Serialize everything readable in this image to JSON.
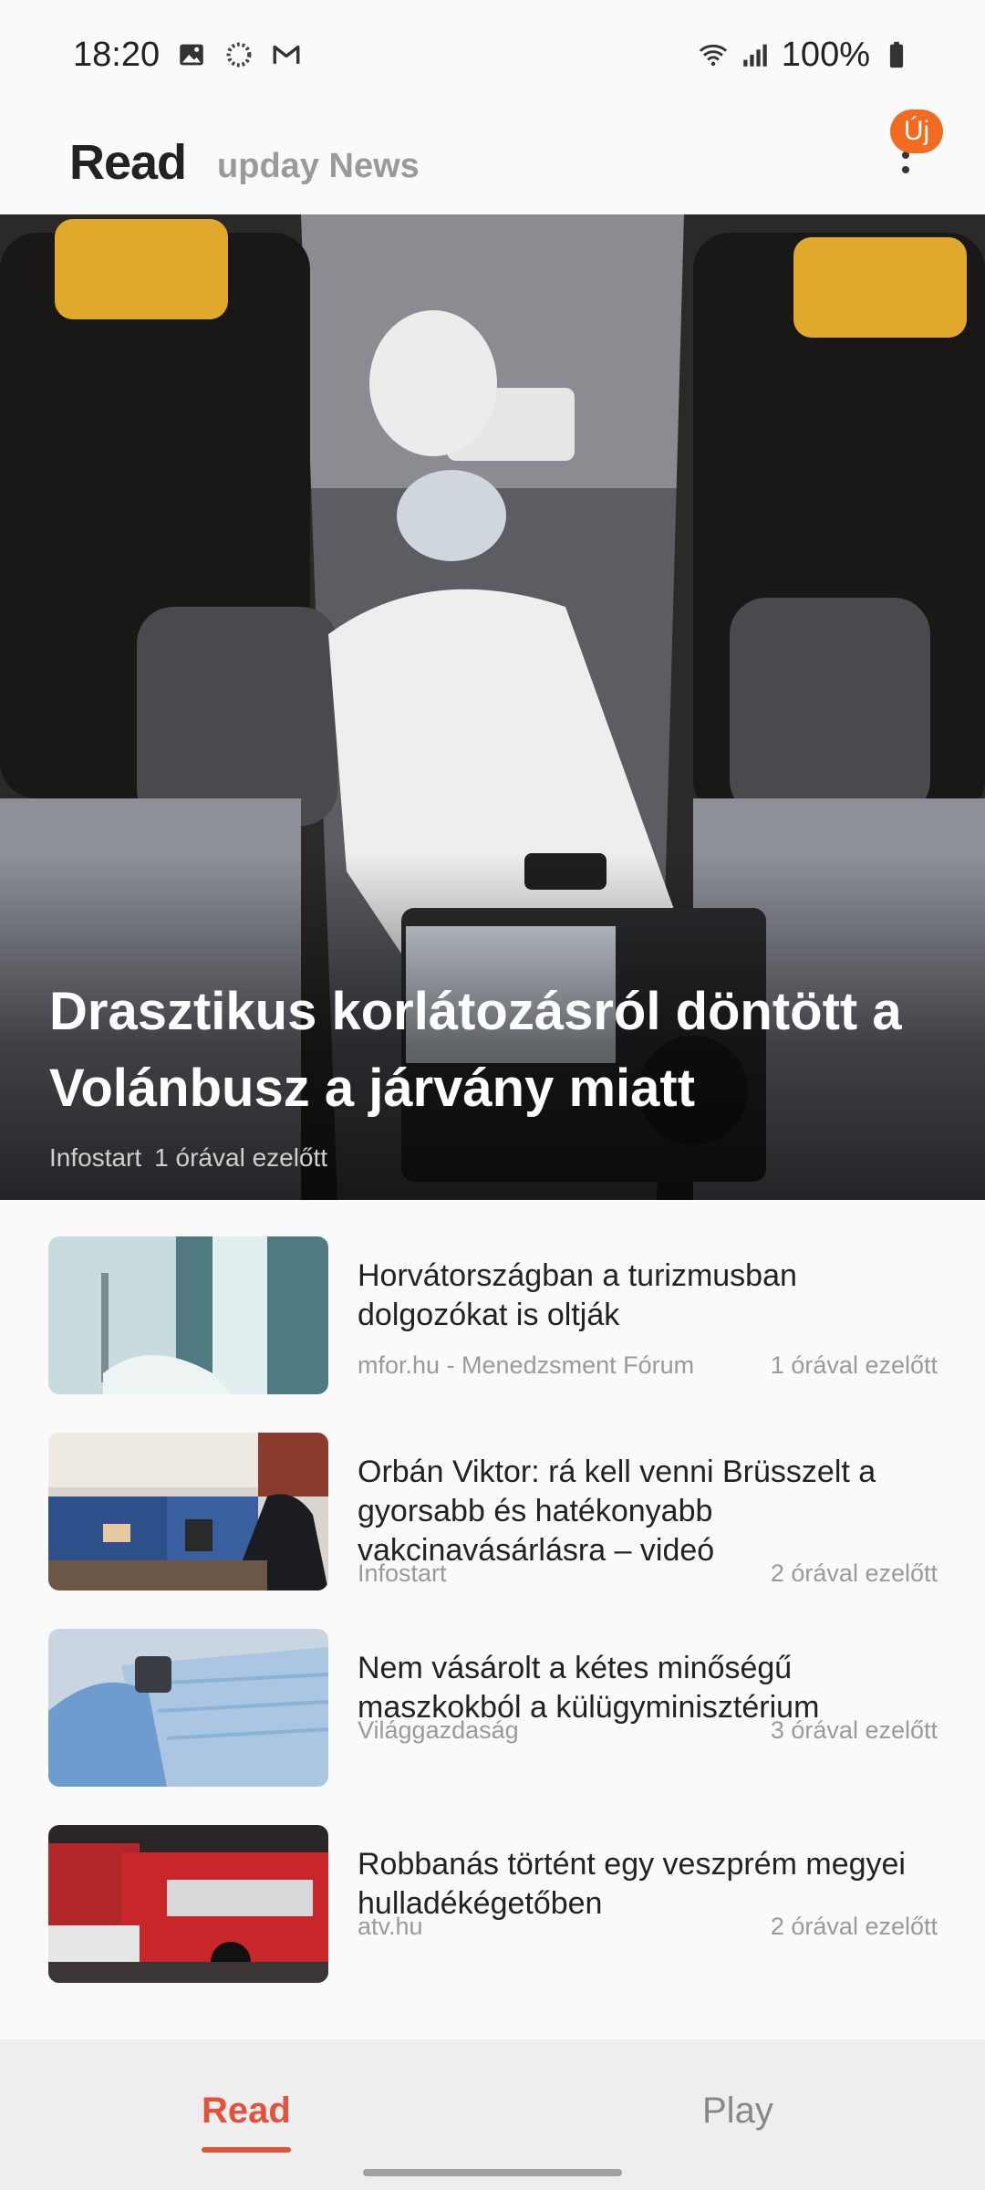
{
  "status_bar": {
    "time": "18:20",
    "battery": "100%",
    "icons": [
      "image-icon",
      "sync-icon",
      "gmail-icon",
      "wifi-icon",
      "signal-icon",
      "battery-icon"
    ]
  },
  "header": {
    "title": "Read",
    "subtitle": "upday News",
    "badge": "Új",
    "menu_icon": "more-vert-icon"
  },
  "hero": {
    "title": "Drasztikus korlátozásról döntött a Volánbusz a járvány miatt",
    "source": "Infostart",
    "time": "1 órával ezelőtt"
  },
  "articles": [
    {
      "title": "Horvátországban a turizmusban dolgozókat is oltják",
      "source": "mfor.hu - Menedzsment Fórum",
      "time": "1 órával ezelőtt"
    },
    {
      "title": "Orbán Viktor: rá kell venni Brüsszelt a gyorsabb és hatékonyabb vakcinavásárlásra – videó",
      "source": "Infostart",
      "time": "2 órával ezelőtt"
    },
    {
      "title": "Nem vásárolt a kétes minőségű maszkokból a külügyminisztérium",
      "source": "Világgazdaság",
      "time": "3 órával ezelőtt"
    },
    {
      "title": "Robbanás történt egy veszprém megyei hulladékégetőben",
      "source": "atv.hu",
      "time": "2 órával ezelőtt"
    }
  ],
  "bottom_nav": {
    "tabs": [
      {
        "label": "Read",
        "active": true
      },
      {
        "label": "Play",
        "active": false
      }
    ]
  },
  "colors": {
    "accent": "#e1533d",
    "badge": "#f26b21"
  }
}
